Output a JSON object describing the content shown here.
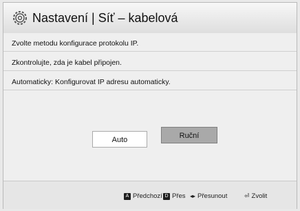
{
  "header": {
    "title": "Nastavení | Síť – kabelová"
  },
  "content": {
    "lines": [
      "Zvolte metodu konfigurace protokolu IP.",
      "Zkontrolujte, zda je kabel připojen.",
      "Automaticky: Konfigurovat IP adresu automaticky."
    ],
    "buttons": {
      "auto": "Auto",
      "manual": "Ruční"
    }
  },
  "footer": {
    "prev_key": "A",
    "prev_label": "Předchozí",
    "skip_key": "D",
    "skip_label": "Přes",
    "move_glyph": "◂▸",
    "move_label": "Přesunout",
    "select_glyph": "⏎",
    "select_label": "Zvolit"
  },
  "colors": {
    "selected_button": "#a9a9a9",
    "background": "#efefef"
  }
}
